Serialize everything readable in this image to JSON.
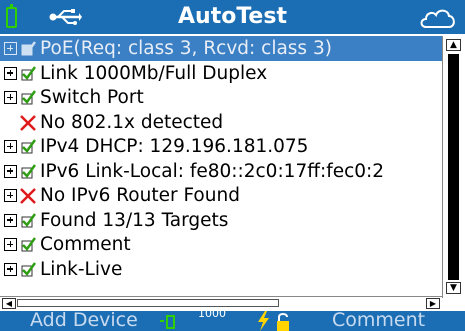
{
  "header": {
    "title": "AutoTest",
    "battery_icon": "battery-icon",
    "usb_icon": "usb-icon",
    "cloud_icon": "cloud-icon",
    "bar_color": "#1b6eb3",
    "battery_color": "#2fd000"
  },
  "results": [
    {
      "label": "PoE(Req: class 3, Rcvd: class 3)",
      "status": "pass",
      "expandable": true,
      "selected": true
    },
    {
      "label": "Link 1000Mb/Full Duplex",
      "status": "pass",
      "expandable": true,
      "selected": false
    },
    {
      "label": "Switch Port",
      "status": "pass",
      "expandable": true,
      "selected": false
    },
    {
      "label": "No 802.1x detected",
      "status": "fail",
      "expandable": false,
      "selected": false
    },
    {
      "label": "IPv4 DHCP: 129.196.181.075",
      "status": "pass",
      "expandable": true,
      "selected": false
    },
    {
      "label": "IPv6 Link-Local: fe80::2c0:17ff:fec0:2",
      "status": "pass",
      "expandable": true,
      "selected": false
    },
    {
      "label": "No IPv6 Router Found",
      "status": "fail",
      "expandable": true,
      "selected": false
    },
    {
      "label": "Found 13/13 Targets",
      "status": "pass",
      "expandable": true,
      "selected": false
    },
    {
      "label": "Comment",
      "status": "pass",
      "expandable": true,
      "selected": false
    },
    {
      "label": "Link-Live",
      "status": "pass",
      "expandable": true,
      "selected": false
    }
  ],
  "footer": {
    "left_button": "Add Device",
    "right_button": "Comment",
    "speed": "1000",
    "status_icons": [
      "link-icon",
      "bolt-icon",
      "lock-icon"
    ]
  },
  "colors": {
    "selection": "#3b7fc4",
    "pass_check": "#2e9e12",
    "fail_cross": "#e01a1a"
  }
}
